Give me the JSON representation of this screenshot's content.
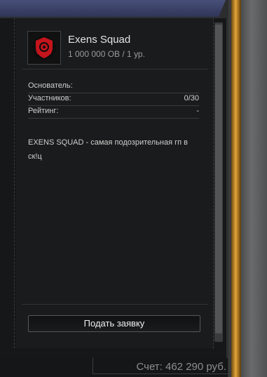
{
  "squad": {
    "name": "Exens Squad",
    "subtitle": "1 000 000 ОВ / 1 ур.",
    "emblem_icon": "red-shield-icon"
  },
  "stats": [
    {
      "label": "Основатель:",
      "value": ""
    },
    {
      "label": "Участников:",
      "value": "0/30"
    },
    {
      "label": "Рейтинг:",
      "value": "-"
    }
  ],
  "description": "EXENS SQUAD - самая подозрительная гп в ск!ц",
  "apply_button": "Подать заявку",
  "balance": "Счет: 462 290 руб.",
  "colors": {
    "accent_gold": "#e3a43a",
    "emblem_red": "#c4141c"
  }
}
